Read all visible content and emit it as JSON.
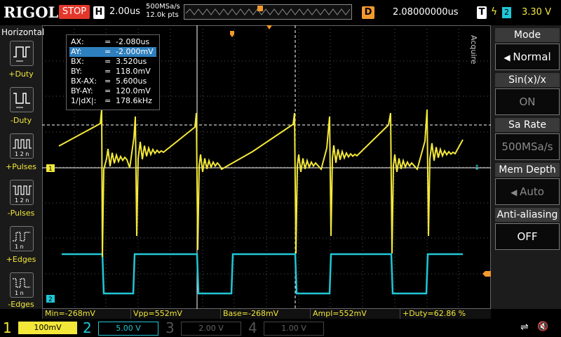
{
  "brand": "RIGOL",
  "run_state": "STOP",
  "timebase": {
    "label": "H",
    "value": "2.00us",
    "sample_rate": "500MSa/s",
    "points": "12.0k pts"
  },
  "delay": {
    "label": "D",
    "value": "2.08000000us"
  },
  "trigger": {
    "label": "T",
    "source": "2",
    "level": "3.30 V"
  },
  "left_panel": {
    "title": "Horizontal",
    "items": [
      {
        "label": "+Duty",
        "icon": "positive-duty-icon"
      },
      {
        "label": "-Duty",
        "icon": "negative-duty-icon"
      },
      {
        "label": "+Pulses",
        "icon": "positive-pulses-icon"
      },
      {
        "label": "-Pulses",
        "icon": "negative-pulses-icon"
      },
      {
        "label": "+Edges",
        "icon": "rising-edges-icon"
      },
      {
        "label": "-Edges",
        "icon": "falling-edges-icon"
      }
    ]
  },
  "cursors": {
    "rows": [
      {
        "key": "AX:",
        "eq": "=",
        "val": "-2.080us"
      },
      {
        "key": "AY:",
        "eq": "=",
        "val": "-2.000mV"
      },
      {
        "key": "BX:",
        "eq": "=",
        "val": "3.520us"
      },
      {
        "key": "BY:",
        "eq": "=",
        "val": "118.0mV"
      },
      {
        "key": "BX-AX:",
        "eq": "=",
        "val": "5.600us"
      },
      {
        "key": "BY-AY:",
        "eq": "=",
        "val": "120.0mV"
      },
      {
        "key": "1/|dX|:",
        "eq": "=",
        "val": "178.6kHz"
      }
    ]
  },
  "measurements": [
    "Min=-268mV",
    "Vpp=552mV",
    "Base=-268mV",
    "Ampl=552mV",
    "+Duty=62.86 %"
  ],
  "right_panel": {
    "vertical_label": "Acquire",
    "groups": [
      {
        "title": "Mode",
        "value": "Normal",
        "dim": false
      },
      {
        "title": "Sin(x)/x",
        "value": "ON",
        "dim": true
      },
      {
        "title": "Sa Rate",
        "value": "500MSa/s",
        "dim": true
      },
      {
        "title": "Mem Depth",
        "value": "Auto",
        "dim": true
      },
      {
        "title": "Anti-aliasing",
        "value": "OFF",
        "dim": false
      }
    ]
  },
  "channels": [
    {
      "num": "1",
      "scale": "100mV",
      "color": "#f3e83a",
      "active": true
    },
    {
      "num": "2",
      "scale": "5.00 V",
      "color": "#20c7d6",
      "active": true
    },
    {
      "num": "3",
      "scale": "2.00 V",
      "color": "#c24ac8",
      "active": false
    },
    {
      "num": "4",
      "scale": "1.00 V",
      "color": "#3b6fd6",
      "active": false
    }
  ],
  "markers": {
    "ch1": "1",
    "ch2": "2"
  },
  "colors": {
    "ch1": "#f3e83a",
    "ch2": "#20c7d6",
    "accent": "#f39a2f",
    "stop": "#e4372b"
  }
}
